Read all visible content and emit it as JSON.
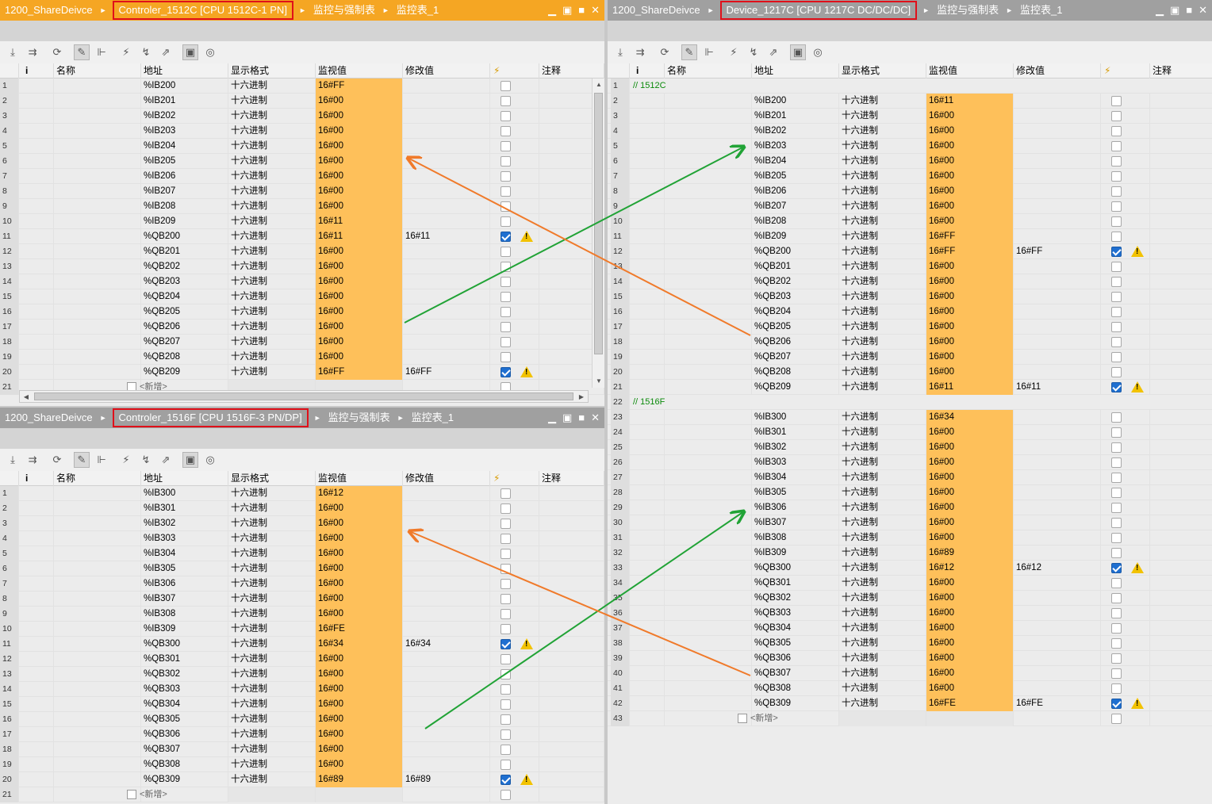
{
  "panels": {
    "pA": {
      "breadcrumbs": [
        "1200_ShareDeivce",
        "Controler_1512C [CPU 1512C-1 PN]",
        "监控与强制表",
        "监控表_1"
      ],
      "active": true,
      "new_label": "<新增>",
      "rows": [
        {
          "n": "1",
          "addr": "%IB200",
          "fmt": "十六进制",
          "mon": "16#FF",
          "mod": "",
          "force": false,
          "warn": false
        },
        {
          "n": "2",
          "addr": "%IB201",
          "fmt": "十六进制",
          "mon": "16#00",
          "mod": "",
          "force": false,
          "warn": false
        },
        {
          "n": "3",
          "addr": "%IB202",
          "fmt": "十六进制",
          "mon": "16#00",
          "mod": "",
          "force": false,
          "warn": false
        },
        {
          "n": "4",
          "addr": "%IB203",
          "fmt": "十六进制",
          "mon": "16#00",
          "mod": "",
          "force": false,
          "warn": false
        },
        {
          "n": "5",
          "addr": "%IB204",
          "fmt": "十六进制",
          "mon": "16#00",
          "mod": "",
          "force": false,
          "warn": false
        },
        {
          "n": "6",
          "addr": "%IB205",
          "fmt": "十六进制",
          "mon": "16#00",
          "mod": "",
          "force": false,
          "warn": false
        },
        {
          "n": "7",
          "addr": "%IB206",
          "fmt": "十六进制",
          "mon": "16#00",
          "mod": "",
          "force": false,
          "warn": false
        },
        {
          "n": "8",
          "addr": "%IB207",
          "fmt": "十六进制",
          "mon": "16#00",
          "mod": "",
          "force": false,
          "warn": false
        },
        {
          "n": "9",
          "addr": "%IB208",
          "fmt": "十六进制",
          "mon": "16#00",
          "mod": "",
          "force": false,
          "warn": false
        },
        {
          "n": "10",
          "addr": "%IB209",
          "fmt": "十六进制",
          "mon": "16#11",
          "mod": "",
          "force": false,
          "warn": false
        },
        {
          "n": "11",
          "addr": "%QB200",
          "fmt": "十六进制",
          "mon": "16#11",
          "mod": "16#11",
          "force": true,
          "warn": true
        },
        {
          "n": "12",
          "addr": "%QB201",
          "fmt": "十六进制",
          "mon": "16#00",
          "mod": "",
          "force": false,
          "warn": false
        },
        {
          "n": "13",
          "addr": "%QB202",
          "fmt": "十六进制",
          "mon": "16#00",
          "mod": "",
          "force": false,
          "warn": false
        },
        {
          "n": "14",
          "addr": "%QB203",
          "fmt": "十六进制",
          "mon": "16#00",
          "mod": "",
          "force": false,
          "warn": false
        },
        {
          "n": "15",
          "addr": "%QB204",
          "fmt": "十六进制",
          "mon": "16#00",
          "mod": "",
          "force": false,
          "warn": false
        },
        {
          "n": "16",
          "addr": "%QB205",
          "fmt": "十六进制",
          "mon": "16#00",
          "mod": "",
          "force": false,
          "warn": false
        },
        {
          "n": "17",
          "addr": "%QB206",
          "fmt": "十六进制",
          "mon": "16#00",
          "mod": "",
          "force": false,
          "warn": false
        },
        {
          "n": "18",
          "addr": "%QB207",
          "fmt": "十六进制",
          "mon": "16#00",
          "mod": "",
          "force": false,
          "warn": false
        },
        {
          "n": "19",
          "addr": "%QB208",
          "fmt": "十六进制",
          "mon": "16#00",
          "mod": "",
          "force": false,
          "warn": false
        },
        {
          "n": "20",
          "addr": "%QB209",
          "fmt": "十六进制",
          "mon": "16#FF",
          "mod": "16#FF",
          "force": true,
          "warn": true
        },
        {
          "n": "21",
          "new": true
        }
      ]
    },
    "pB": {
      "breadcrumbs": [
        "1200_ShareDeivce",
        "Controler_1516F [CPU 1516F-3 PN/DP]",
        "监控与强制表",
        "监控表_1"
      ],
      "active": false,
      "new_label": "<新增>",
      "rows": [
        {
          "n": "1",
          "addr": "%IB300",
          "fmt": "十六进制",
          "mon": "16#12",
          "mod": "",
          "force": false,
          "warn": false
        },
        {
          "n": "2",
          "addr": "%IB301",
          "fmt": "十六进制",
          "mon": "16#00",
          "mod": "",
          "force": false,
          "warn": false
        },
        {
          "n": "3",
          "addr": "%IB302",
          "fmt": "十六进制",
          "mon": "16#00",
          "mod": "",
          "force": false,
          "warn": false
        },
        {
          "n": "4",
          "addr": "%IB303",
          "fmt": "十六进制",
          "mon": "16#00",
          "mod": "",
          "force": false,
          "warn": false
        },
        {
          "n": "5",
          "addr": "%IB304",
          "fmt": "十六进制",
          "mon": "16#00",
          "mod": "",
          "force": false,
          "warn": false
        },
        {
          "n": "6",
          "addr": "%IB305",
          "fmt": "十六进制",
          "mon": "16#00",
          "mod": "",
          "force": false,
          "warn": false
        },
        {
          "n": "7",
          "addr": "%IB306",
          "fmt": "十六进制",
          "mon": "16#00",
          "mod": "",
          "force": false,
          "warn": false
        },
        {
          "n": "8",
          "addr": "%IB307",
          "fmt": "十六进制",
          "mon": "16#00",
          "mod": "",
          "force": false,
          "warn": false
        },
        {
          "n": "9",
          "addr": "%IB308",
          "fmt": "十六进制",
          "mon": "16#00",
          "mod": "",
          "force": false,
          "warn": false
        },
        {
          "n": "10",
          "addr": "%IB309",
          "fmt": "十六进制",
          "mon": "16#FE",
          "mod": "",
          "force": false,
          "warn": false
        },
        {
          "n": "11",
          "addr": "%QB300",
          "fmt": "十六进制",
          "mon": "16#34",
          "mod": "16#34",
          "force": true,
          "warn": true
        },
        {
          "n": "12",
          "addr": "%QB301",
          "fmt": "十六进制",
          "mon": "16#00",
          "mod": "",
          "force": false,
          "warn": false
        },
        {
          "n": "13",
          "addr": "%QB302",
          "fmt": "十六进制",
          "mon": "16#00",
          "mod": "",
          "force": false,
          "warn": false
        },
        {
          "n": "14",
          "addr": "%QB303",
          "fmt": "十六进制",
          "mon": "16#00",
          "mod": "",
          "force": false,
          "warn": false
        },
        {
          "n": "15",
          "addr": "%QB304",
          "fmt": "十六进制",
          "mon": "16#00",
          "mod": "",
          "force": false,
          "warn": false
        },
        {
          "n": "16",
          "addr": "%QB305",
          "fmt": "十六进制",
          "mon": "16#00",
          "mod": "",
          "force": false,
          "warn": false
        },
        {
          "n": "17",
          "addr": "%QB306",
          "fmt": "十六进制",
          "mon": "16#00",
          "mod": "",
          "force": false,
          "warn": false
        },
        {
          "n": "18",
          "addr": "%QB307",
          "fmt": "十六进制",
          "mon": "16#00",
          "mod": "",
          "force": false,
          "warn": false
        },
        {
          "n": "19",
          "addr": "%QB308",
          "fmt": "十六进制",
          "mon": "16#00",
          "mod": "",
          "force": false,
          "warn": false
        },
        {
          "n": "20",
          "addr": "%QB309",
          "fmt": "十六进制",
          "mon": "16#89",
          "mod": "16#89",
          "force": true,
          "warn": true
        },
        {
          "n": "21",
          "new": true
        }
      ]
    },
    "pC": {
      "breadcrumbs": [
        "1200_ShareDeivce",
        "Device_1217C [CPU 1217C DC/DC/DC]",
        "监控与强制表",
        "监控表_1"
      ],
      "active": false,
      "new_label": "<新增>",
      "rows": [
        {
          "n": "1",
          "comment": "// 1512C"
        },
        {
          "n": "2",
          "addr": "%IB200",
          "fmt": "十六进制",
          "mon": "16#11",
          "mod": "",
          "force": false,
          "warn": false
        },
        {
          "n": "3",
          "addr": "%IB201",
          "fmt": "十六进制",
          "mon": "16#00",
          "mod": "",
          "force": false,
          "warn": false
        },
        {
          "n": "4",
          "addr": "%IB202",
          "fmt": "十六进制",
          "mon": "16#00",
          "mod": "",
          "force": false,
          "warn": false
        },
        {
          "n": "5",
          "addr": "%IB203",
          "fmt": "十六进制",
          "mon": "16#00",
          "mod": "",
          "force": false,
          "warn": false
        },
        {
          "n": "6",
          "addr": "%IB204",
          "fmt": "十六进制",
          "mon": "16#00",
          "mod": "",
          "force": false,
          "warn": false
        },
        {
          "n": "7",
          "addr": "%IB205",
          "fmt": "十六进制",
          "mon": "16#00",
          "mod": "",
          "force": false,
          "warn": false
        },
        {
          "n": "8",
          "addr": "%IB206",
          "fmt": "十六进制",
          "mon": "16#00",
          "mod": "",
          "force": false,
          "warn": false
        },
        {
          "n": "9",
          "addr": "%IB207",
          "fmt": "十六进制",
          "mon": "16#00",
          "mod": "",
          "force": false,
          "warn": false
        },
        {
          "n": "10",
          "addr": "%IB208",
          "fmt": "十六进制",
          "mon": "16#00",
          "mod": "",
          "force": false,
          "warn": false
        },
        {
          "n": "11",
          "addr": "%IB209",
          "fmt": "十六进制",
          "mon": "16#FF",
          "mod": "",
          "force": false,
          "warn": false
        },
        {
          "n": "12",
          "addr": "%QB200",
          "fmt": "十六进制",
          "mon": "16#FF",
          "mod": "16#FF",
          "force": true,
          "warn": true
        },
        {
          "n": "13",
          "addr": "%QB201",
          "fmt": "十六进制",
          "mon": "16#00",
          "mod": "",
          "force": false,
          "warn": false
        },
        {
          "n": "14",
          "addr": "%QB202",
          "fmt": "十六进制",
          "mon": "16#00",
          "mod": "",
          "force": false,
          "warn": false
        },
        {
          "n": "15",
          "addr": "%QB203",
          "fmt": "十六进制",
          "mon": "16#00",
          "mod": "",
          "force": false,
          "warn": false
        },
        {
          "n": "16",
          "addr": "%QB204",
          "fmt": "十六进制",
          "mon": "16#00",
          "mod": "",
          "force": false,
          "warn": false
        },
        {
          "n": "17",
          "addr": "%QB205",
          "fmt": "十六进制",
          "mon": "16#00",
          "mod": "",
          "force": false,
          "warn": false
        },
        {
          "n": "18",
          "addr": "%QB206",
          "fmt": "十六进制",
          "mon": "16#00",
          "mod": "",
          "force": false,
          "warn": false
        },
        {
          "n": "19",
          "addr": "%QB207",
          "fmt": "十六进制",
          "mon": "16#00",
          "mod": "",
          "force": false,
          "warn": false
        },
        {
          "n": "20",
          "addr": "%QB208",
          "fmt": "十六进制",
          "mon": "16#00",
          "mod": "",
          "force": false,
          "warn": false
        },
        {
          "n": "21",
          "addr": "%QB209",
          "fmt": "十六进制",
          "mon": "16#11",
          "mod": "16#11",
          "force": true,
          "warn": true
        },
        {
          "n": "22",
          "comment": "// 1516F"
        },
        {
          "n": "23",
          "addr": "%IB300",
          "fmt": "十六进制",
          "mon": "16#34",
          "mod": "",
          "force": false,
          "warn": false
        },
        {
          "n": "24",
          "addr": "%IB301",
          "fmt": "十六进制",
          "mon": "16#00",
          "mod": "",
          "force": false,
          "warn": false
        },
        {
          "n": "25",
          "addr": "%IB302",
          "fmt": "十六进制",
          "mon": "16#00",
          "mod": "",
          "force": false,
          "warn": false
        },
        {
          "n": "26",
          "addr": "%IB303",
          "fmt": "十六进制",
          "mon": "16#00",
          "mod": "",
          "force": false,
          "warn": false
        },
        {
          "n": "27",
          "addr": "%IB304",
          "fmt": "十六进制",
          "mon": "16#00",
          "mod": "",
          "force": false,
          "warn": false
        },
        {
          "n": "28",
          "addr": "%IB305",
          "fmt": "十六进制",
          "mon": "16#00",
          "mod": "",
          "force": false,
          "warn": false
        },
        {
          "n": "29",
          "addr": "%IB306",
          "fmt": "十六进制",
          "mon": "16#00",
          "mod": "",
          "force": false,
          "warn": false
        },
        {
          "n": "30",
          "addr": "%IB307",
          "fmt": "十六进制",
          "mon": "16#00",
          "mod": "",
          "force": false,
          "warn": false
        },
        {
          "n": "31",
          "addr": "%IB308",
          "fmt": "十六进制",
          "mon": "16#00",
          "mod": "",
          "force": false,
          "warn": false
        },
        {
          "n": "32",
          "addr": "%IB309",
          "fmt": "十六进制",
          "mon": "16#89",
          "mod": "",
          "force": false,
          "warn": false
        },
        {
          "n": "33",
          "addr": "%QB300",
          "fmt": "十六进制",
          "mon": "16#12",
          "mod": "16#12",
          "force": true,
          "warn": true
        },
        {
          "n": "34",
          "addr": "%QB301",
          "fmt": "十六进制",
          "mon": "16#00",
          "mod": "",
          "force": false,
          "warn": false
        },
        {
          "n": "35",
          "addr": "%QB302",
          "fmt": "十六进制",
          "mon": "16#00",
          "mod": "",
          "force": false,
          "warn": false
        },
        {
          "n": "36",
          "addr": "%QB303",
          "fmt": "十六进制",
          "mon": "16#00",
          "mod": "",
          "force": false,
          "warn": false
        },
        {
          "n": "37",
          "addr": "%QB304",
          "fmt": "十六进制",
          "mon": "16#00",
          "mod": "",
          "force": false,
          "warn": false
        },
        {
          "n": "38",
          "addr": "%QB305",
          "fmt": "十六进制",
          "mon": "16#00",
          "mod": "",
          "force": false,
          "warn": false
        },
        {
          "n": "39",
          "addr": "%QB306",
          "fmt": "十六进制",
          "mon": "16#00",
          "mod": "",
          "force": false,
          "warn": false
        },
        {
          "n": "40",
          "addr": "%QB307",
          "fmt": "十六进制",
          "mon": "16#00",
          "mod": "",
          "force": false,
          "warn": false
        },
        {
          "n": "41",
          "addr": "%QB308",
          "fmt": "十六进制",
          "mon": "16#00",
          "mod": "",
          "force": false,
          "warn": false
        },
        {
          "n": "42",
          "addr": "%QB309",
          "fmt": "十六进制",
          "mon": "16#FE",
          "mod": "16#FE",
          "force": true,
          "warn": true
        },
        {
          "n": "43",
          "new": true
        }
      ]
    }
  },
  "columns": {
    "info": "i",
    "name": "名称",
    "addr": "地址",
    "fmt": "显示格式",
    "mon": "监视值",
    "mod": "修改值",
    "force_icon": "⚡",
    "comment": "注释"
  },
  "toolbar_icons": [
    "insert-row-icon",
    "add-row-icon",
    "refresh-icon",
    "monitor-toggle-icon",
    "monitor-once-icon",
    "modify-now-icon",
    "modify-trigger-icon",
    "force-icon",
    "show-modify-columns-icon",
    "show-extended-columns-icon"
  ],
  "colors": {
    "title_active": "#f5a623",
    "title_inactive": "#a0a0a0",
    "monitor_cell": "#fec05a",
    "highlight_box": "#e0101a",
    "arrow_green": "#21a336",
    "arrow_orange": "#f07a2a"
  }
}
